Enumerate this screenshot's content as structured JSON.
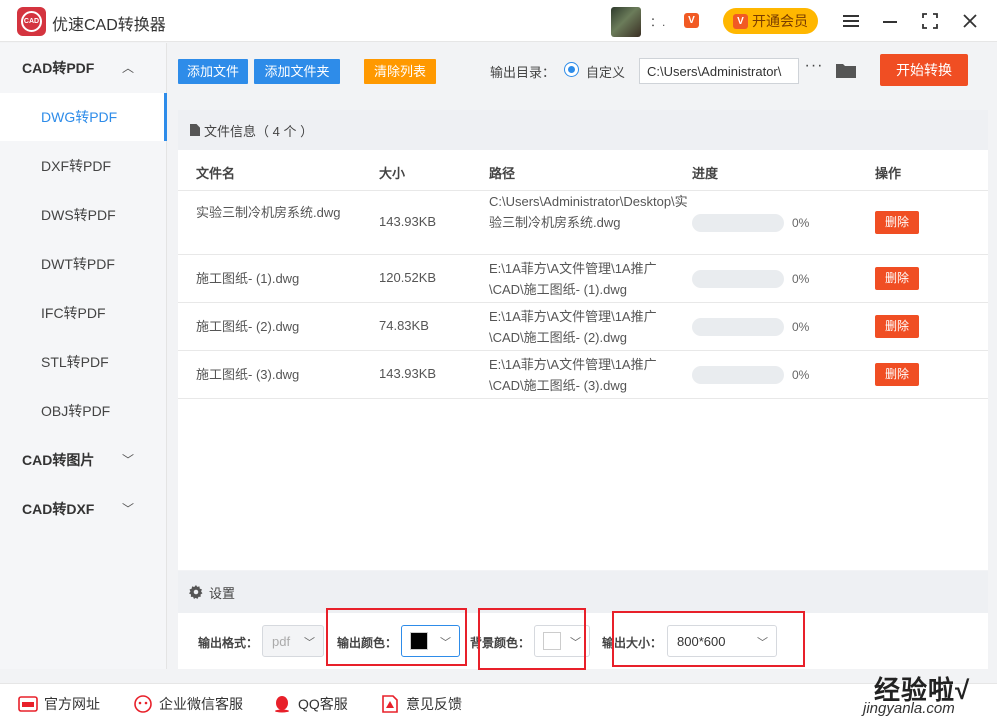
{
  "app": {
    "title": "优速CAD转换器",
    "logo_text": "CAD",
    "username": "：.",
    "vip_badge": "V",
    "vip_button": "开通会员"
  },
  "window_controls": [
    "menu-icon",
    "minimize-icon",
    "maximize-icon",
    "close-icon"
  ],
  "sidebar": {
    "groups": [
      {
        "label": "CAD转PDF",
        "expanded": true,
        "items": [
          "DWG转PDF",
          "DXF转PDF",
          "DWS转PDF",
          "DWT转PDF",
          "IFC转PDF",
          "STL转PDF",
          "OBJ转PDF"
        ],
        "active": "DWG转PDF"
      },
      {
        "label": "CAD转图片",
        "expanded": false
      },
      {
        "label": "CAD转DXF",
        "expanded": false
      }
    ],
    "chev_up": "︿",
    "chev_down": "﹀"
  },
  "toolbar": {
    "add_file": "添加文件",
    "add_folder": "添加文件夹",
    "clear_list": "清除列表",
    "output_dir_label": "输出目录：",
    "radio_label": "自定义",
    "output_path": "C:\\Users\\Administrator\\",
    "more": "···",
    "start": "开始转换"
  },
  "files": {
    "header": "文件信息（ 4 个 ）",
    "columns": {
      "name": "文件名",
      "size": "大小",
      "path": "路径",
      "progress": "进度",
      "action": "操作"
    },
    "rows": [
      {
        "name": "实验三制冷机房系统.dwg",
        "size": "143.93KB",
        "path": "C:\\Users\\Administrator\\Desktop\\实验三制冷机房系统.dwg",
        "progress": 0,
        "progress_text": "0%",
        "action": "删除"
      },
      {
        "name": "施工图纸- (1).dwg",
        "size": "120.52KB",
        "path": "E:\\1A菲方\\A文件管理\\1A推广\\CAD\\施工图纸- (1).dwg",
        "progress": 0,
        "progress_text": "0%",
        "action": "删除"
      },
      {
        "name": "施工图纸- (2).dwg",
        "size": "74.83KB",
        "path": "E:\\1A菲方\\A文件管理\\1A推广\\CAD\\施工图纸- (2).dwg",
        "progress": 0,
        "progress_text": "0%",
        "action": "删除"
      },
      {
        "name": "施工图纸- (3).dwg",
        "size": "143.93KB",
        "path": "E:\\1A菲方\\A文件管理\\1A推广\\CAD\\施工图纸- (3).dwg",
        "progress": 0,
        "progress_text": "0%",
        "action": "删除"
      }
    ]
  },
  "settings": {
    "title": "设置",
    "format_label": "输出格式：",
    "format_value": "pdf",
    "color_label": "输出颜色：",
    "color_value": "#000000",
    "bg_label": "背景颜色：",
    "bg_value": "#ffffff",
    "size_label": "输出大小：",
    "size_value": "800*600"
  },
  "footer": {
    "links": [
      "官方网址",
      "企业微信客服",
      "QQ客服",
      "意见反馈"
    ]
  },
  "watermark": {
    "text": "经验啦√",
    "sub": "jingyanla.com"
  },
  "colors": {
    "accent": "#2e8ce9",
    "danger": "#f04e23",
    "warning": "#ff9900",
    "vip": "#ffb700",
    "highlight": "#e8202a"
  }
}
